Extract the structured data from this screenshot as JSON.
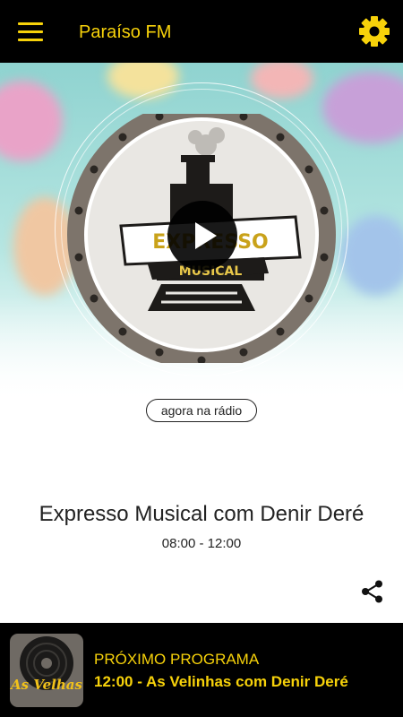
{
  "header": {
    "title": "Paraíso FM",
    "menu_icon": "hamburger-menu-icon",
    "settings_icon": "gear-icon",
    "accent_color": "#f7d20a",
    "background_color": "#000000"
  },
  "now_playing": {
    "badge": "agora na rádio",
    "cover_text_top": "EXPRESSO",
    "cover_text_bottom": "MUSICAL",
    "title": "Expresso Musical com Denir Deré",
    "time": "08:00 - 12:00",
    "play_icon": "play-icon",
    "share_icon": "share-icon"
  },
  "next_program": {
    "label": "PRÓXIMO PROGRAMA",
    "program": "12:00 - As Velinhas com Denir Deré",
    "thumb_text": "As Velhas"
  }
}
